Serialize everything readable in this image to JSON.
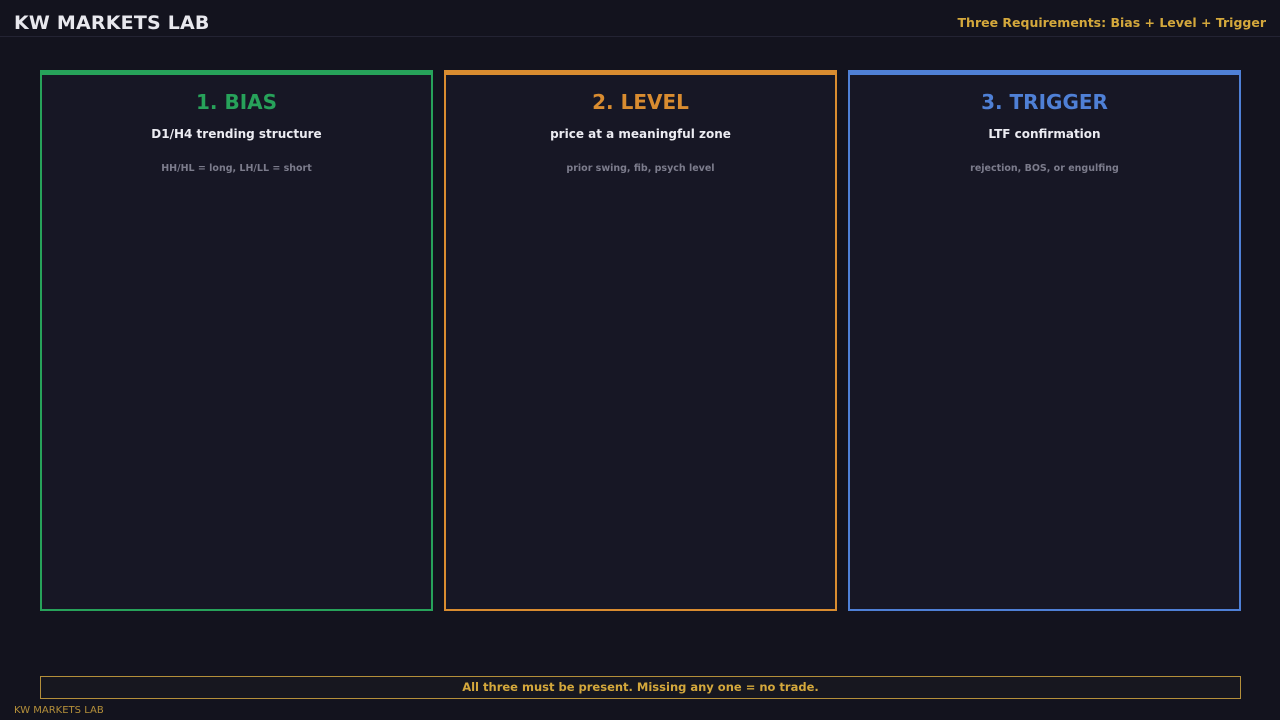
{
  "header": {
    "brand": "KW MARKETS LAB",
    "subtitle": "Three Requirements: Bias + Level + Trigger"
  },
  "cards": [
    {
      "title": "1. BIAS",
      "subtitle": "D1/H4 trending structure",
      "detail": "HH/HL = long, LH/LL = short",
      "color": "#27a25a"
    },
    {
      "title": "2. LEVEL",
      "subtitle": "price at a meaningful zone",
      "detail": "prior swing, fib, psych level",
      "color": "#d98c30"
    },
    {
      "title": "3. TRIGGER",
      "subtitle": "LTF confirmation",
      "detail": "rejection, BOS, or engulfing",
      "color": "#4f80d6"
    }
  ],
  "rule": "All three must be present. Missing any one = no trade.",
  "footer": {
    "brand": "KW MARKETS LAB"
  },
  "colors": {
    "background": "#13131e",
    "accent": "#d4a83c"
  }
}
